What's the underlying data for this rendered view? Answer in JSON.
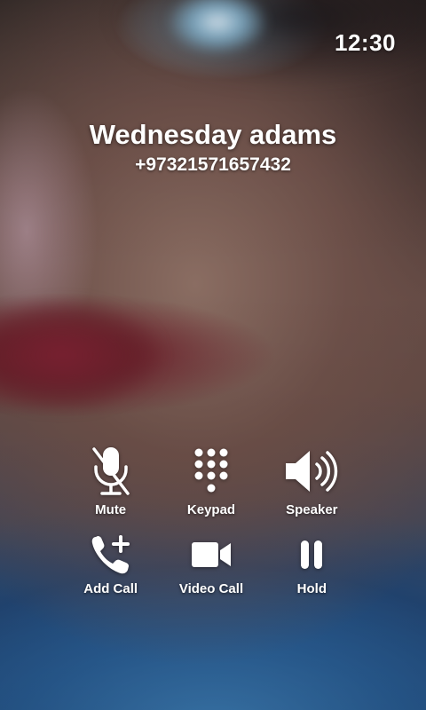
{
  "status_bar": {
    "time": "12:30"
  },
  "caller": {
    "name": "Wednesday adams",
    "number": "+97321571657432"
  },
  "controls": [
    {
      "label": "Mute",
      "icon": "mic-off-icon"
    },
    {
      "label": "Keypad",
      "icon": "dialpad-icon"
    },
    {
      "label": "Speaker",
      "icon": "speaker-icon"
    },
    {
      "label": "Add Call",
      "icon": "add-call-icon"
    },
    {
      "label": "Video Call",
      "icon": "video-camera-icon"
    },
    {
      "label": "Hold",
      "icon": "pause-icon"
    }
  ]
}
